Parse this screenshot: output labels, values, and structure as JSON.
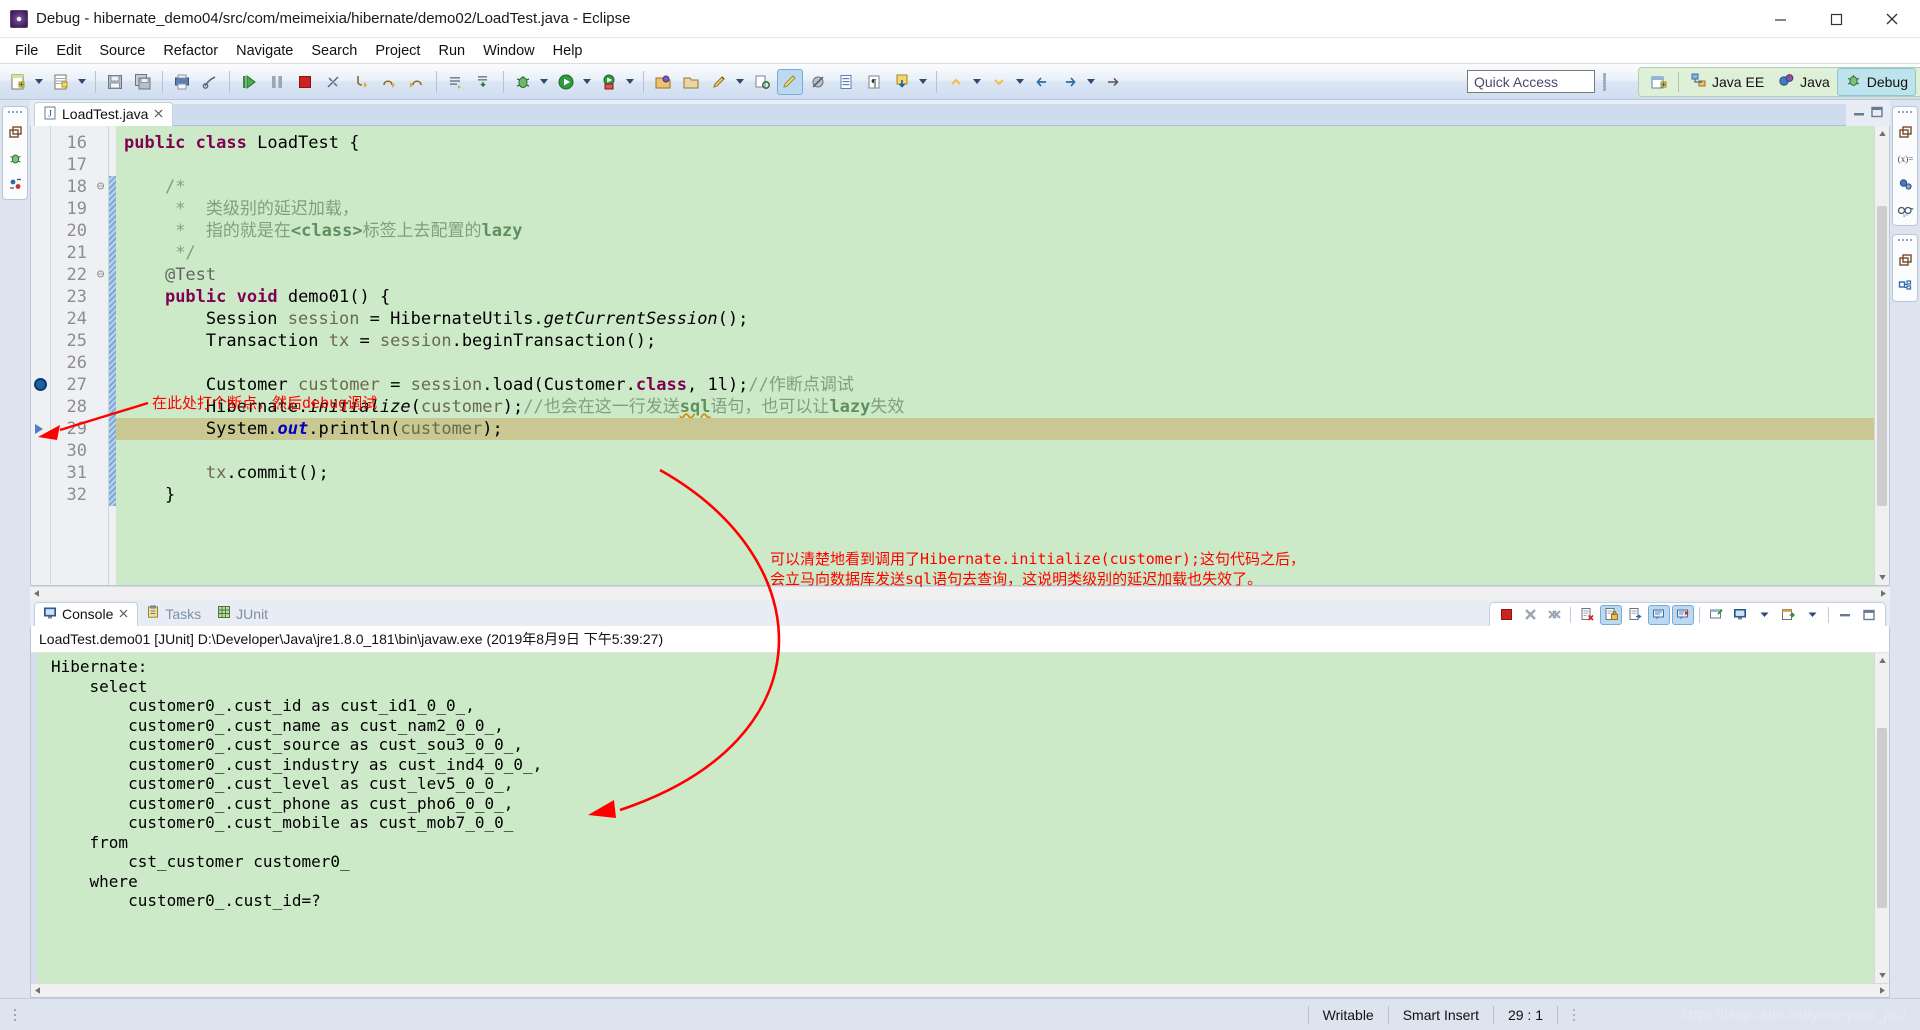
{
  "window": {
    "title": "Debug - hibernate_demo04/src/com/meimeixia/hibernate/demo02/LoadTest.java - Eclipse",
    "app_icon": "eclipse-icon",
    "minimize": "minimize-icon",
    "maximize": "maximize-icon",
    "close": "close-icon"
  },
  "menubar": {
    "items": [
      "File",
      "Edit",
      "Source",
      "Refactor",
      "Navigate",
      "Search",
      "Project",
      "Run",
      "Window",
      "Help"
    ]
  },
  "toolbar": {
    "quick_access": "Quick Access",
    "perspectives": [
      {
        "label": "Java EE",
        "selected": false
      },
      {
        "label": "Java",
        "selected": false
      },
      {
        "label": "Debug",
        "selected": true
      }
    ],
    "open_perspective_icon": "open-perspective-icon"
  },
  "editor": {
    "tab_label": "LoadTest.java",
    "tab_icon": "java-file-icon",
    "close_icon": "close-tab-icon",
    "first_line": 16,
    "exec_line": 29,
    "breakpoint_line": 27,
    "lines": [
      {
        "n": 16,
        "fold": "",
        "html": "<span class=\"kw\">public</span> <span class=\"kw\">class</span> <span class=\"plain\">LoadTest {</span>"
      },
      {
        "n": 17,
        "fold": "",
        "html": ""
      },
      {
        "n": 18,
        "fold": "-",
        "html": "    <span class=\"cm\">/*</span>"
      },
      {
        "n": 19,
        "fold": "",
        "html": "     <span class=\"cm\">*  类级别的延迟加载，</span>"
      },
      {
        "n": 20,
        "fold": "",
        "html": "     <span class=\"cm\">*  指的就是在<span class=\"cmk\">&lt;class&gt;</span>标签上去配置的<span class=\"cmk\">lazy</span></span>"
      },
      {
        "n": 21,
        "fold": "",
        "html": "     <span class=\"cm\">*/</span>"
      },
      {
        "n": 22,
        "fold": "-",
        "html": "    <span class=\"ann\">@Test</span>"
      },
      {
        "n": 23,
        "fold": "",
        "html": "    <span class=\"kw\">public</span> <span class=\"kw\">void</span> <span class=\"plain\">demo01() {</span>"
      },
      {
        "n": 24,
        "fold": "",
        "html": "        <span class=\"plain\">Session </span><span class=\"loc\">session</span><span class=\"plain\"> = HibernateUtils.</span><span class=\"stat\">getCurrentSession</span><span class=\"plain\">();</span>"
      },
      {
        "n": 25,
        "fold": "",
        "html": "        <span class=\"plain\">Transaction </span><span class=\"loc\">tx</span><span class=\"plain\"> = </span><span class=\"loc\">session</span><span class=\"plain\">.beginTransaction();</span>"
      },
      {
        "n": 26,
        "fold": "",
        "html": ""
      },
      {
        "n": 27,
        "fold": "",
        "html": "        <span class=\"plain\">Customer </span><span class=\"loc\">customer</span><span class=\"plain\"> = </span><span class=\"loc\">session</span><span class=\"plain\">.load(Customer.</span><span class=\"kw\">class</span><span class=\"plain\">, 1l);</span><span class=\"cm\">//作断点调试</span>"
      },
      {
        "n": 28,
        "fold": "",
        "html": "        <span class=\"plain\">Hibernate.</span><span class=\"stat\">initialize</span><span class=\"plain\">(</span><span class=\"loc\">customer</span><span class=\"plain\">);</span><span class=\"cm\">//也会在这一行发送<span class=\"cmk squig\">sql</span>语句，也可以让<span class=\"cmk\">lazy</span>失效</span>"
      },
      {
        "n": 29,
        "fold": "",
        "html": "        <span class=\"plain\">System.</span><span class=\"fld\">out</span><span class=\"plain\">.println(</span><span class=\"loc\">customer</span><span class=\"plain\">);</span>"
      },
      {
        "n": 30,
        "fold": "",
        "html": ""
      },
      {
        "n": 31,
        "fold": "",
        "html": "        <span class=\"loc\">tx</span><span class=\"plain\">.commit();</span>"
      },
      {
        "n": 32,
        "fold": "",
        "html": "    <span class=\"plain\">}</span>"
      }
    ]
  },
  "annotations": {
    "note_breakpoint": "在此处打个断点，然后debug调试",
    "note_result_line1": "可以清楚地看到调用了Hibernate.initialize(customer);这句代码之后，",
    "note_result_line2": "会立马向数据库发送sql语句去查询，这说明类级别的延迟加载也失效了。"
  },
  "console": {
    "tabs": [
      {
        "label": "Console",
        "icon": "console-icon",
        "selected": true,
        "closable": true
      },
      {
        "label": "Tasks",
        "icon": "tasks-icon",
        "selected": false,
        "closable": false
      },
      {
        "label": "JUnit",
        "icon": "junit-icon",
        "selected": false,
        "closable": false
      }
    ],
    "launch_title": "LoadTest.demo01 [JUnit] D:\\Developer\\Java\\jre1.8.0_181\\bin\\javaw.exe (2019年8月9日 下午5:39:27)",
    "output": "Hibernate: \n    select\n        customer0_.cust_id as cust_id1_0_0_,\n        customer0_.cust_name as cust_nam2_0_0_,\n        customer0_.cust_source as cust_sou3_0_0_,\n        customer0_.cust_industry as cust_ind4_0_0_,\n        customer0_.cust_level as cust_lev5_0_0_,\n        customer0_.cust_phone as cust_pho6_0_0_,\n        customer0_.cust_mobile as cust_mob7_0_0_\n    from\n        cst_customer customer0_\n    where\n        customer0_.cust_id=?",
    "toolbar_icons": [
      "terminate-icon",
      "remove-launch-icon",
      "remove-all-terminated-icon",
      "clear-console-icon",
      "scroll-lock-icon",
      "word-wrap-icon",
      "show-console-on-output-icon",
      "show-console-on-error-icon",
      "pin-console-icon",
      "display-selected-console-icon",
      "display-selected-console-arrow",
      "open-console-icon",
      "open-console-arrow",
      "minimize-icon",
      "maximize-icon"
    ]
  },
  "statusbar": {
    "writable": "Writable",
    "insert_mode": "Smart Insert",
    "cursor_position": "29 : 1",
    "watermark": "https://blog.csdn.net/yerenyuan_pku"
  },
  "colors": {
    "editor_bg": "#cdeac8",
    "exec_line": "#c9c893",
    "keyword": "#7f0055",
    "comment": "#7f9f7f",
    "annotation_red": "#ff0000",
    "perspective_bar": "#dff0d8",
    "selected_perspective": "#bde3ec"
  }
}
